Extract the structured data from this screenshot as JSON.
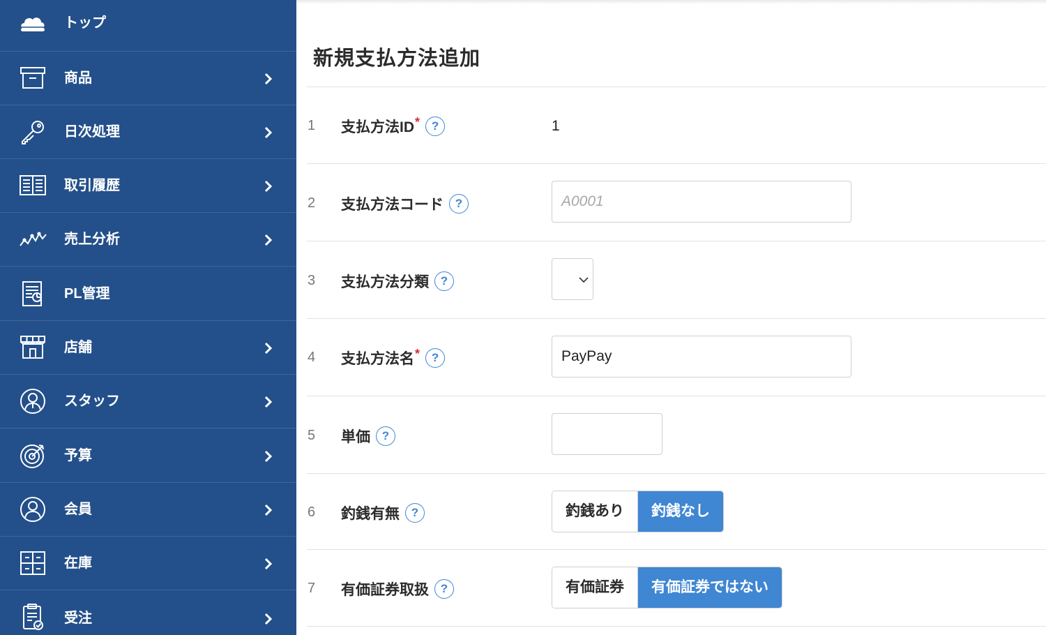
{
  "sidebar": {
    "items": [
      {
        "label": "トップ",
        "icon": "cloud-icon",
        "has_chevron": false
      },
      {
        "label": "商品",
        "icon": "archive-box-icon",
        "has_chevron": true
      },
      {
        "label": "日次処理",
        "icon": "key-icon",
        "has_chevron": true
      },
      {
        "label": "取引履歴",
        "icon": "open-book-icon",
        "has_chevron": true
      },
      {
        "label": "売上分析",
        "icon": "line-chart-icon",
        "has_chevron": true
      },
      {
        "label": "PL管理",
        "icon": "report-icon",
        "has_chevron": false
      },
      {
        "label": "店舗",
        "icon": "storefront-icon",
        "has_chevron": true
      },
      {
        "label": "スタッフ",
        "icon": "staff-person-icon",
        "has_chevron": true
      },
      {
        "label": "予算",
        "icon": "target-icon",
        "has_chevron": true
      },
      {
        "label": "会員",
        "icon": "member-person-icon",
        "has_chevron": true
      },
      {
        "label": "在庫",
        "icon": "inventory-boxes-icon",
        "has_chevron": true
      },
      {
        "label": "受注",
        "icon": "clipboard-check-icon",
        "has_chevron": true
      }
    ]
  },
  "main": {
    "title": "新規支払方法追加",
    "rows": [
      {
        "num": "1",
        "label": "支払方法ID",
        "required": true,
        "value": "1"
      },
      {
        "num": "2",
        "label": "支払方法コード",
        "required": false,
        "placeholder": "A0001"
      },
      {
        "num": "3",
        "label": "支払方法分類",
        "required": false,
        "value": ""
      },
      {
        "num": "4",
        "label": "支払方法名",
        "required": true,
        "value": "PayPay"
      },
      {
        "num": "5",
        "label": "単価",
        "required": false,
        "value": ""
      },
      {
        "num": "6",
        "label": "釣銭有無",
        "required": false,
        "options": [
          "釣銭あり",
          "釣銭なし"
        ],
        "selected": "釣銭なし"
      },
      {
        "num": "7",
        "label": "有価証券取扱",
        "required": false,
        "options": [
          "有価証券",
          "有価証券ではない"
        ],
        "selected": "有価証券ではない"
      }
    ],
    "required_mark": "*",
    "help_glyph": "?"
  },
  "colors": {
    "sidebar_bg": "#23508a",
    "accent": "#3f86d3",
    "required": "#d32f2f"
  }
}
